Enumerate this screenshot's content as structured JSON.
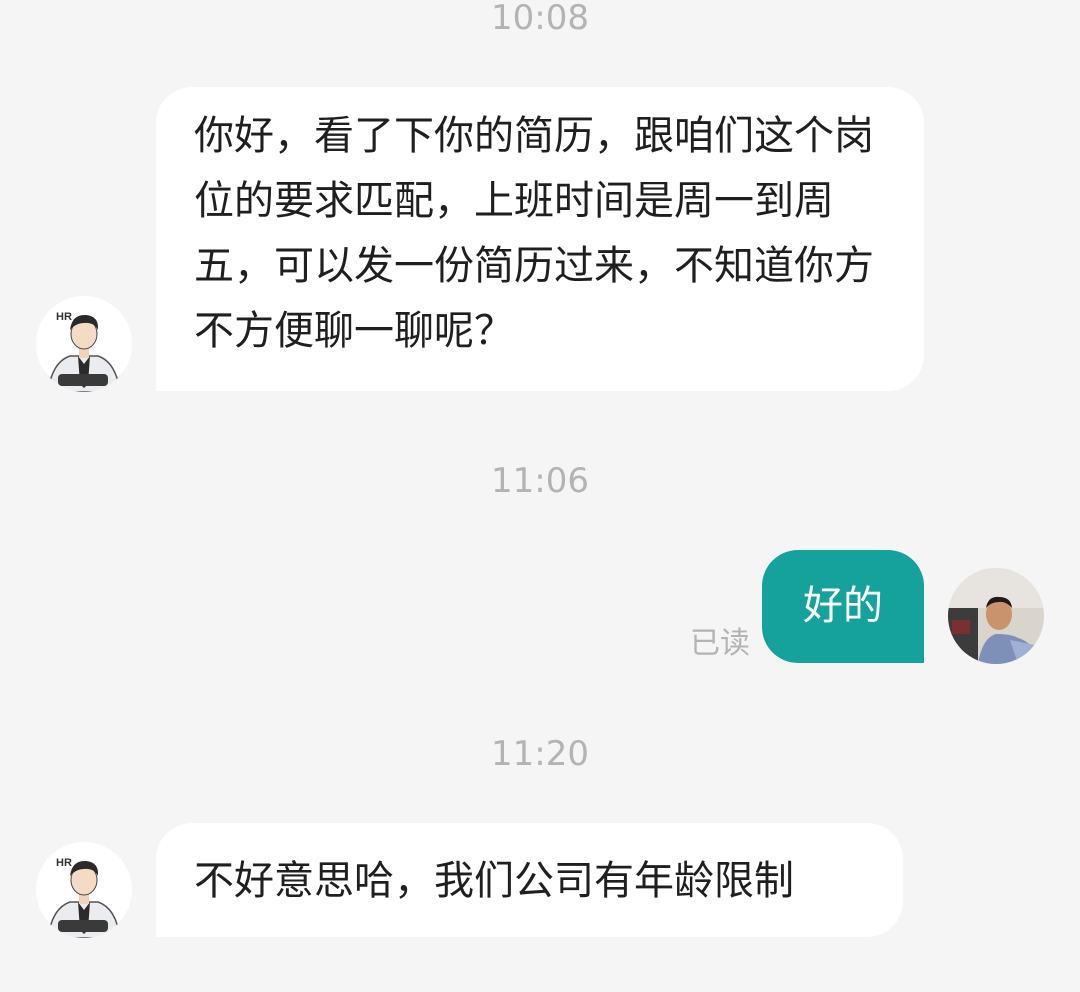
{
  "conversation": {
    "messages": [
      {
        "type": "time",
        "text": "10:08"
      },
      {
        "type": "incoming",
        "sender_avatar": "hr-avatar",
        "text": "你好，看了下你的简历，跟咱们这个岗位的要求匹配，上班时间是周一到周五，可以发一份简历过来，不知道你方不方便聊一聊呢？"
      },
      {
        "type": "time",
        "text": "11:06"
      },
      {
        "type": "outgoing",
        "sender_avatar": "user-avatar",
        "text": "好的",
        "status": "已读"
      },
      {
        "type": "time",
        "text": "11:20"
      },
      {
        "type": "incoming",
        "sender_avatar": "hr-avatar",
        "text": "不好意思哈，我们公司有年龄限制"
      }
    ]
  },
  "hr_avatar": {
    "badge_text": "HR"
  },
  "colors": {
    "background": "#f5f5f5",
    "incoming_bubble": "#ffffff",
    "outgoing_bubble": "#15a19c",
    "timestamp_text": "#b3b3b3"
  }
}
